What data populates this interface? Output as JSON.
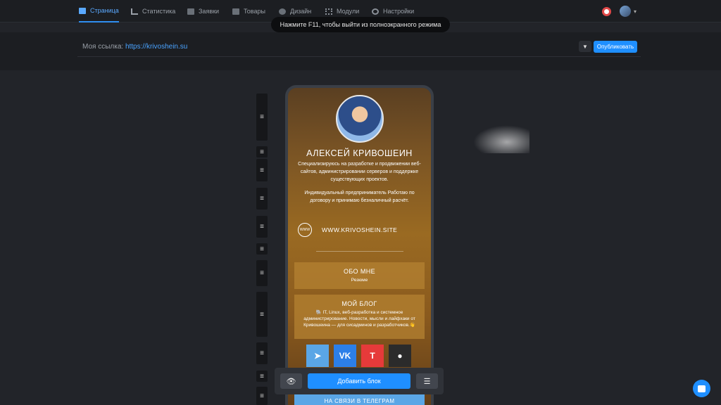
{
  "nav": {
    "tabs": [
      {
        "label": "Страница",
        "icon": "page-icon",
        "active": true
      },
      {
        "label": "Статистика",
        "icon": "stats-icon",
        "active": false
      },
      {
        "label": "Заявки",
        "icon": "requests-icon",
        "active": false
      },
      {
        "label": "Товары",
        "icon": "products-icon",
        "active": false
      },
      {
        "label": "Дизайн",
        "icon": "design-icon",
        "active": false
      },
      {
        "label": "Модули",
        "icon": "modules-icon",
        "active": false
      },
      {
        "label": "Настройки",
        "icon": "settings-icon",
        "active": false
      }
    ]
  },
  "toast": {
    "text": "Нажмите F11, чтобы выйти из полноэкранного режима"
  },
  "linkbar": {
    "label": "Моя ссылка:",
    "url": "https://krivoshein.su",
    "publish_label": "Опубликовать"
  },
  "profile": {
    "name": "АЛЕКСЕЙ КРИВОШЕИН",
    "description": "Специализируюсь на разработке и продвижении веб-сайтов, администрировании серверов и поддержке существующих проектов.",
    "description2": "Индивидуальный предприниматель Работаю по договору и принимаю безналичный расчёт.",
    "www_icon_text": "WWW",
    "website": "WWW.KRIVOSHEIN.SITE"
  },
  "cards": [
    {
      "title": "ОБО МНЕ",
      "subtitle": "Резюме"
    },
    {
      "title": "МОЙ БЛОГ",
      "subtitle": "🐘 IT, Linux, веб-разработка и системное администрирование. Новости, мысли и лайфхаки от Кривошеина — для сисадминов и разработчиков.👋"
    }
  ],
  "socials": [
    {
      "name": "telegram",
      "glyph": "➤",
      "color": "#5aa6e6"
    },
    {
      "name": "vk",
      "glyph": "VK",
      "color": "#2c7fe8"
    },
    {
      "name": "tenchat",
      "glyph": "T",
      "color": "#e63a3a"
    },
    {
      "name": "github",
      "glyph": "●",
      "color": "#2b2b2b"
    }
  ],
  "telegram_button": "НА СВЯЗИ В ТЕЛЕГРАМ",
  "toolbar": {
    "add_block_label": "Добавить блок"
  },
  "colors": {
    "accent": "#1f8fff",
    "active_tab": "#5aa9ff"
  }
}
